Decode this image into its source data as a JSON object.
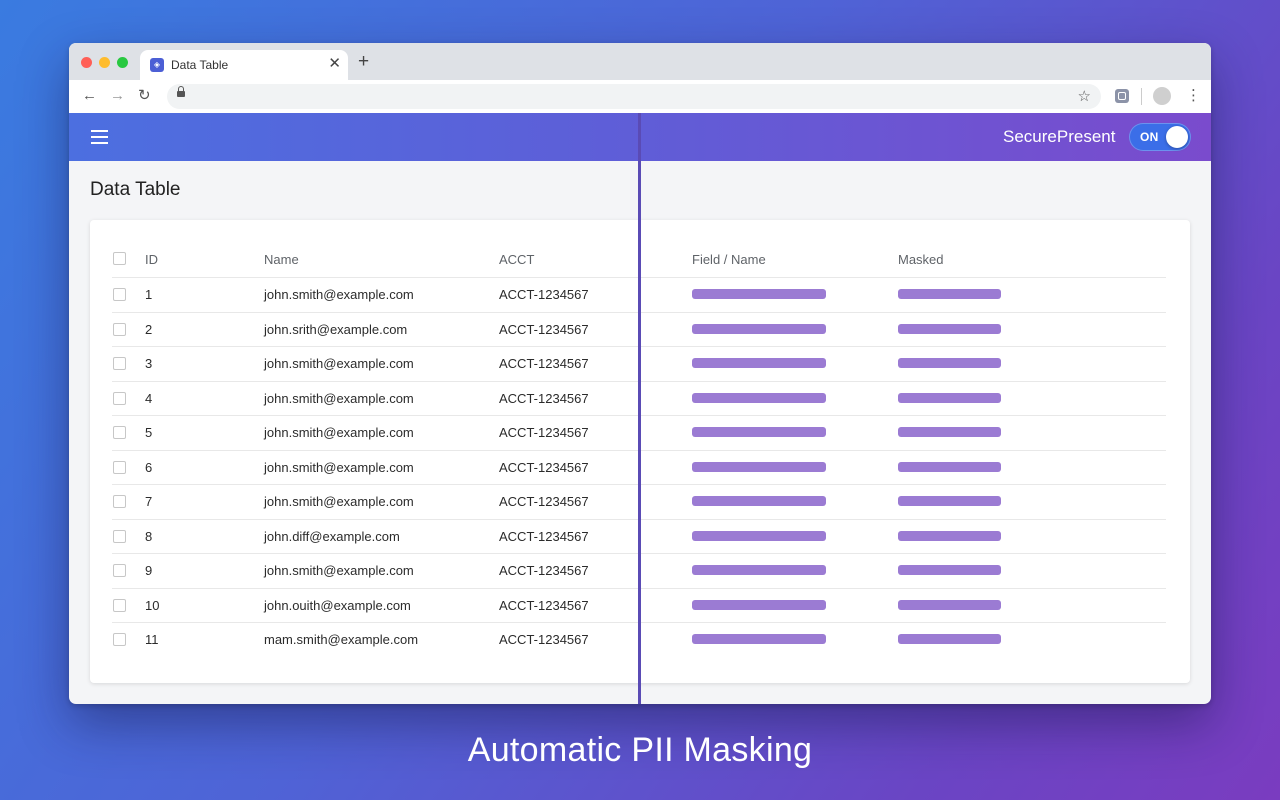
{
  "browser": {
    "traffic_lights": {
      "close_color": "#ff5f57",
      "minimize_color": "#febc2e",
      "zoom_color": "#28c840"
    },
    "tab": {
      "title": "Data Table",
      "favicon": "shield-icon",
      "close_glyph": "✕"
    },
    "new_tab_glyph": "+",
    "toolbar": {
      "back_glyph": "←",
      "forward_glyph": "→",
      "reload_glyph": "↻",
      "star_glyph": "☆",
      "menu_glyph": "⋮"
    }
  },
  "app": {
    "brand": "SecurePresent",
    "toggle": {
      "label": "ON",
      "state": "on"
    },
    "accent_color": "#5a4bb5",
    "mask_color": "#9b7bd3"
  },
  "page": {
    "title": "Data Table"
  },
  "table": {
    "left_headers": {
      "id": "ID",
      "name": "Name",
      "acct": "ACCT"
    },
    "right_headers": {
      "field": "Field / Name",
      "masked": "Masked"
    },
    "rows": [
      {
        "id": "1",
        "name": "john.smith@example.com",
        "acct": "ACCT-1234567"
      },
      {
        "id": "2",
        "name": "john.srith@example.com",
        "acct": "ACCT-1234567"
      },
      {
        "id": "3",
        "name": "john.smith@example.com",
        "acct": "ACCT-1234567"
      },
      {
        "id": "4",
        "name": "john.smith@example.com",
        "acct": "ACCT-1234567"
      },
      {
        "id": "5",
        "name": "john.smith@example.com",
        "acct": "ACCT-1234567"
      },
      {
        "id": "6",
        "name": "john.smith@example.com",
        "acct": "ACCT-1234567"
      },
      {
        "id": "7",
        "name": "john.smith@example.com",
        "acct": "ACCT-1234567"
      },
      {
        "id": "8",
        "name": "john.diff@example.com",
        "acct": "ACCT-1234567"
      },
      {
        "id": "9",
        "name": "john.smith@example.com",
        "acct": "ACCT-1234567"
      },
      {
        "id": "10",
        "name": "john.ouith@example.com",
        "acct": "ACCT-1234567"
      },
      {
        "id": "11",
        "name": "mam.smith@example.com",
        "acct": "ACCT-1234567"
      }
    ]
  },
  "caption": "Automatic PII Masking"
}
